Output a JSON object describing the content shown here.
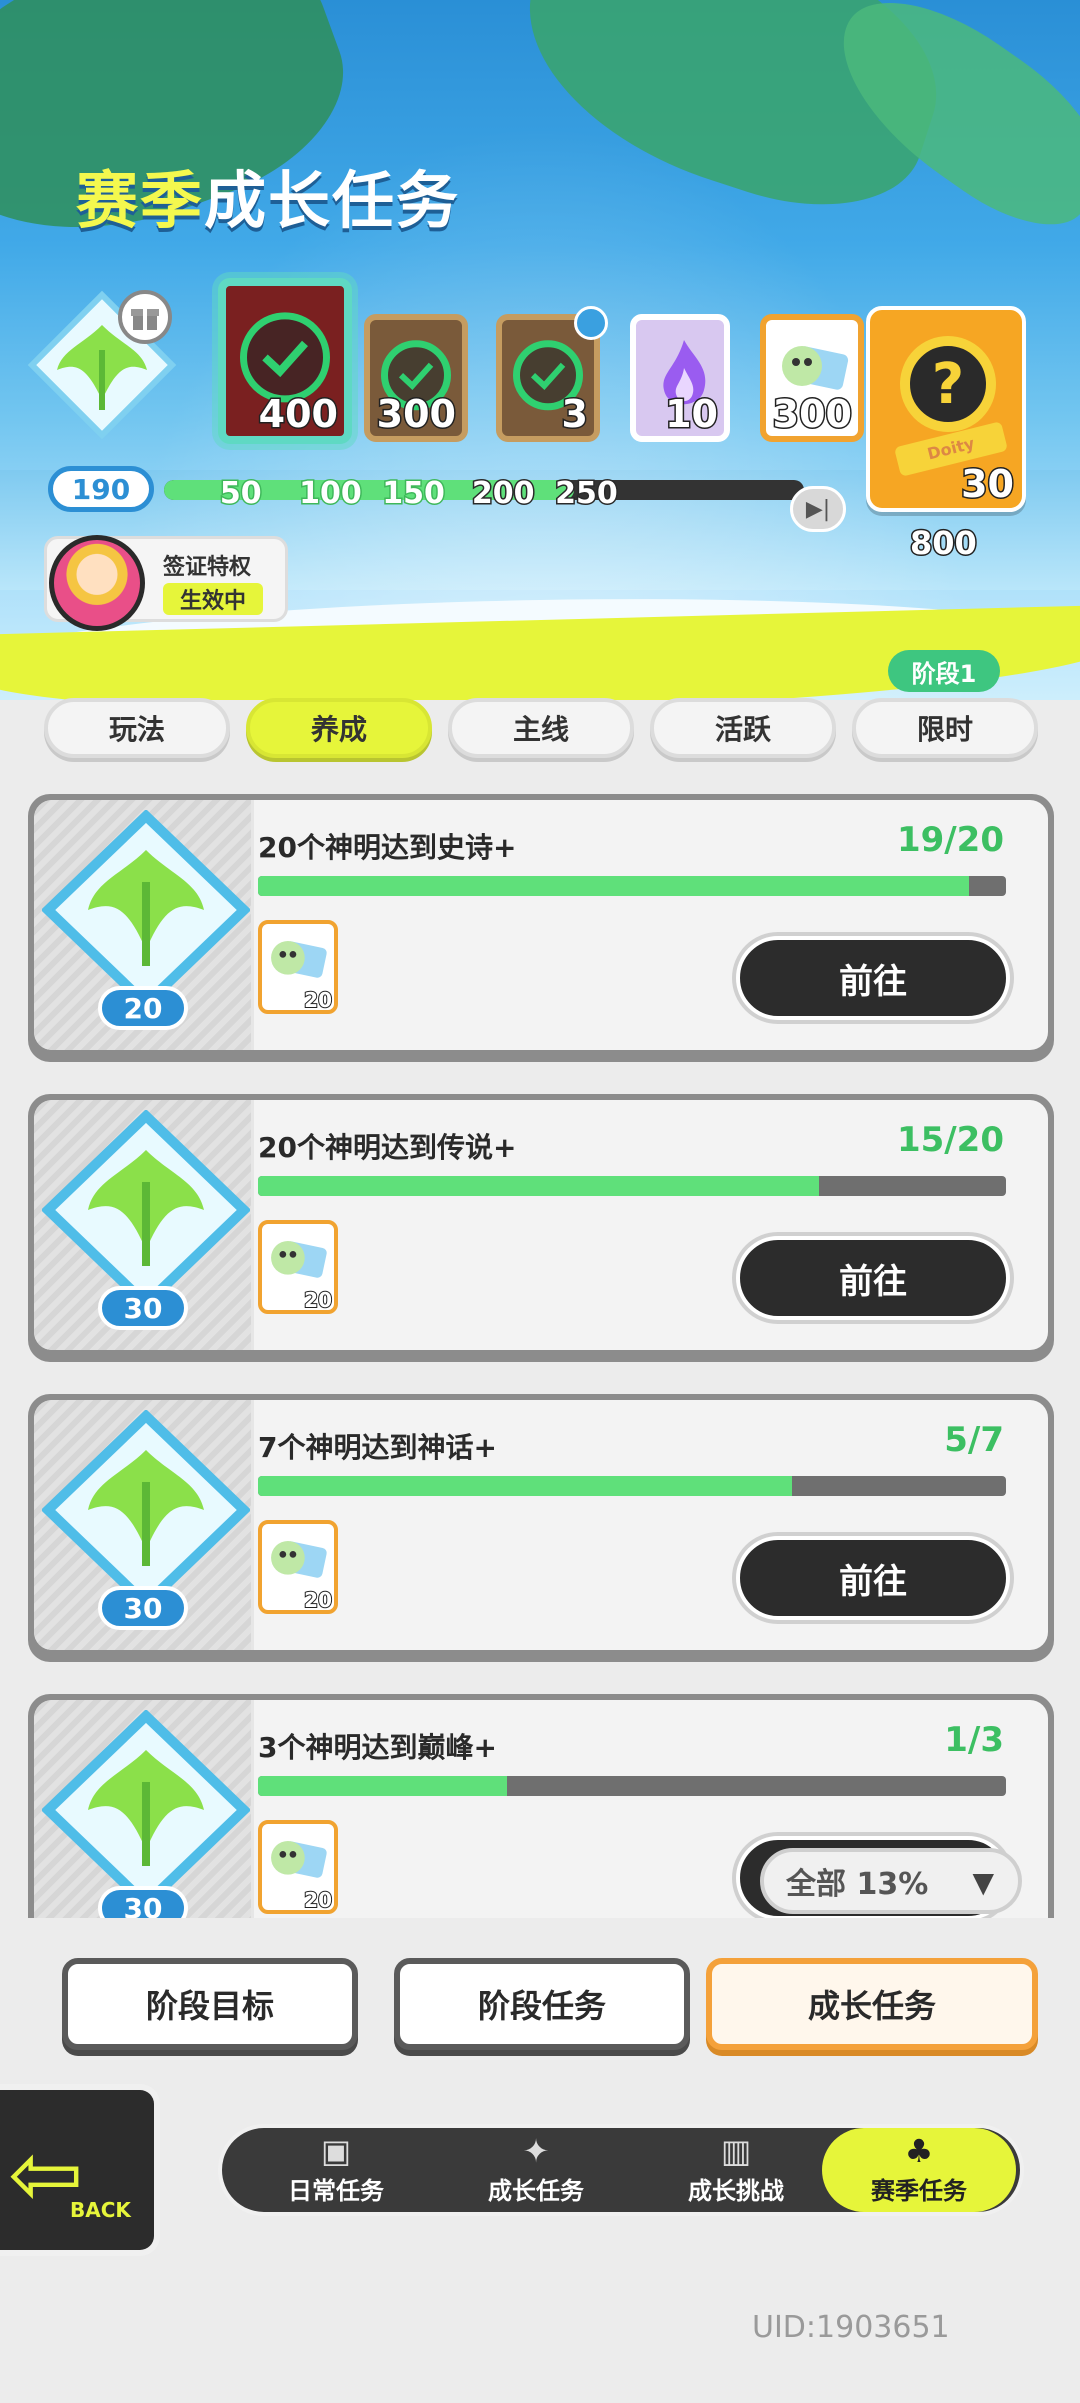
{
  "header": {
    "title_part1": "赛季",
    "title_part2": "成长任务",
    "level": "190",
    "progress_fraction": 0.64,
    "ticks": [
      "50",
      "100",
      "150",
      "200",
      "250"
    ],
    "rewards": [
      {
        "amount": "400",
        "claimed": true
      },
      {
        "amount": "300",
        "claimed": true
      },
      {
        "amount": "3",
        "claimed": true
      },
      {
        "amount": "10",
        "claimed": false
      },
      {
        "amount": "300",
        "claimed": false
      }
    ],
    "final_reward": {
      "amount": "30",
      "threshold": "800",
      "ribbon": "Doity"
    },
    "visa": {
      "label": "签证特权",
      "status": "生效中"
    }
  },
  "tabs": {
    "items": [
      "玩法",
      "养成",
      "主线",
      "活跃",
      "限时"
    ],
    "active": "养成",
    "stage_badge": "阶段1"
  },
  "tasks": [
    {
      "level": "20",
      "title": "20个神明达到史诗+",
      "count": "19/20",
      "progress": 0.95,
      "reward": "20",
      "button": "前往"
    },
    {
      "level": "30",
      "title": "20个神明达到传说+",
      "count": "15/20",
      "progress": 0.75,
      "reward": "20",
      "button": "前往"
    },
    {
      "level": "30",
      "title": "7个神明达到神话+",
      "count": "5/7",
      "progress": 0.714,
      "reward": "20",
      "button": "前往"
    },
    {
      "level": "30",
      "title": "3个神明达到巅峰+",
      "count": "1/3",
      "progress": 0.333,
      "reward": "20",
      "button": "前往"
    }
  ],
  "filter": {
    "label": "全部 13%"
  },
  "sub_tabs": [
    "阶段目标",
    "阶段任务",
    "成长任务"
  ],
  "back": {
    "label": "BACK"
  },
  "nav": [
    {
      "label": "日常任务",
      "icon": "calendar-icon"
    },
    {
      "label": "成长任务",
      "icon": "sparkle-icon"
    },
    {
      "label": "成长挑战",
      "icon": "pillar-icon"
    },
    {
      "label": "赛季任务",
      "icon": "palm-icon"
    }
  ],
  "uid": "UID:1903651",
  "colors": {
    "accent_yellow": "#e6f53a",
    "progress_green": "#5fe07a",
    "count_green": "#3cbf62",
    "orange": "#f4a13a",
    "blue": "#2c8fd4"
  }
}
